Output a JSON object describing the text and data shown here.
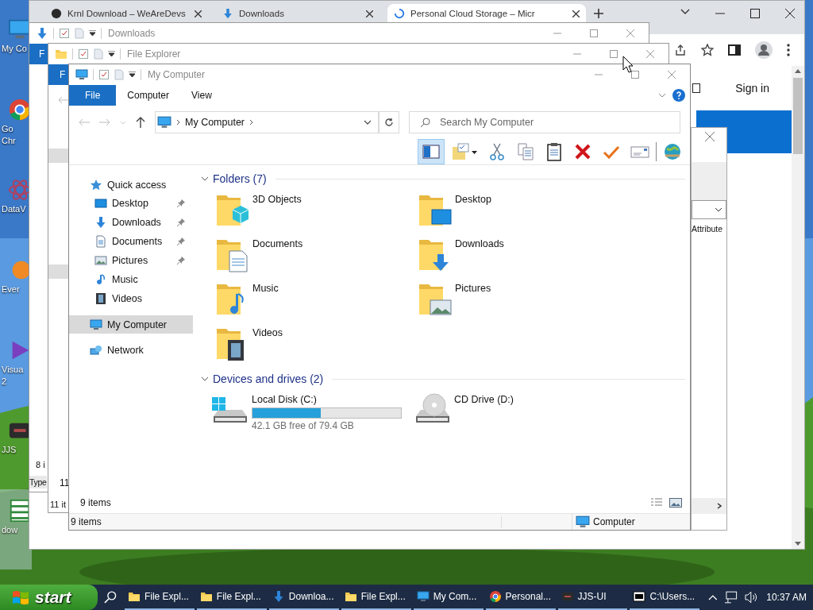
{
  "desktop": {
    "icons": [
      {
        "kind": "computer",
        "lines": [
          "My Co"
        ],
        "selected": false
      },
      {
        "kind": "chrome",
        "lines": [
          "Go",
          "Chr"
        ],
        "selected": false
      },
      {
        "kind": "atom",
        "lines": [
          "DataV"
        ],
        "selected": false
      },
      {
        "kind": "evernote",
        "lines": [
          "Ever"
        ],
        "selected": false
      },
      {
        "kind": "visual-studio",
        "lines": [
          "Visua",
          "2"
        ],
        "selected": false
      },
      {
        "kind": "jjs",
        "lines": [
          "JJS"
        ],
        "selected": false
      },
      {
        "kind": "spreadsheet",
        "lines": [
          "dow"
        ],
        "selected": true
      }
    ]
  },
  "browser": {
    "tabs": [
      {
        "title": "Krnl Download – WeAreDevs",
        "kind": "site",
        "selected": false
      },
      {
        "title": "Downloads",
        "kind": "download",
        "selected": false
      },
      {
        "title": "Personal Cloud Storage – Micr",
        "kind": "loading",
        "selected": true
      }
    ],
    "sign_in": "Sign in"
  },
  "downloads_window": {
    "title": "Downloads",
    "file_tab": "F",
    "item_count": "8 i",
    "column": "Type"
  },
  "file_explorer_window": {
    "title": "File Explorer",
    "file_tab": "F",
    "pane_count": "11",
    "status": "11 it"
  },
  "side_dialog": {
    "column": "Attribute"
  },
  "my_computer": {
    "title": "My Computer",
    "ribbon_tabs": [
      {
        "label": "File",
        "selected": true
      },
      {
        "label": "Computer",
        "selected": false
      },
      {
        "label": "View",
        "selected": false
      }
    ],
    "address": "My Computer",
    "search": {
      "placeholder": "Search My Computer"
    },
    "toolbar": [
      {
        "kind": "preview-pane",
        "selected": true
      },
      {
        "kind": "folder-options",
        "selected": false
      },
      {
        "kind": "cut",
        "selected": false
      },
      {
        "kind": "copy",
        "selected": false
      },
      {
        "kind": "paste",
        "selected": false
      },
      {
        "kind": "delete",
        "selected": false
      },
      {
        "kind": "check",
        "selected": false
      },
      {
        "kind": "envelope",
        "selected": false
      },
      {
        "kind": "globe",
        "selected": false
      }
    ],
    "nav": [
      {
        "label": "Quick access",
        "kind": "star",
        "selected": false,
        "children": [
          {
            "label": "Desktop",
            "kind": "desktop",
            "pinned": true,
            "selected": false
          },
          {
            "label": "Downloads",
            "kind": "downloads",
            "pinned": true,
            "selected": false
          },
          {
            "label": "Documents",
            "kind": "documents",
            "pinned": true,
            "selected": false
          },
          {
            "label": "Pictures",
            "kind": "pictures",
            "pinned": true,
            "selected": false
          },
          {
            "label": "Music",
            "kind": "music",
            "pinned": false,
            "selected": false
          },
          {
            "label": "Videos",
            "kind": "videos",
            "pinned": false,
            "selected": false
          }
        ]
      },
      {
        "label": "My Computer",
        "kind": "computer",
        "selected": true
      },
      {
        "label": "Network",
        "kind": "network",
        "selected": false
      }
    ],
    "folders": {
      "heading": "Folders (7)",
      "expanded": true,
      "items": [
        {
          "name": "3D Objects",
          "kind": "objects"
        },
        {
          "name": "Desktop",
          "kind": "desktop"
        },
        {
          "name": "Documents",
          "kind": "documents"
        },
        {
          "name": "Downloads",
          "kind": "downloads"
        },
        {
          "name": "Music",
          "kind": "music"
        },
        {
          "name": "Pictures",
          "kind": "pictures"
        },
        {
          "name": "Videos",
          "kind": "videos"
        }
      ]
    },
    "drives": {
      "heading": "Devices and drives (2)",
      "expanded": true,
      "items": [
        {
          "name": "Local Disk (C:)",
          "kind": "hdd",
          "level": 0.46,
          "info": "42.1 GB free of 79.4 GB"
        },
        {
          "name": "CD Drive (D:)",
          "kind": "cd"
        }
      ]
    },
    "pane_count": "9 items",
    "status": {
      "count": "9 items",
      "location": "Computer"
    }
  },
  "taskbar": {
    "start": "start",
    "items": [
      {
        "label": "File Expl...",
        "kind": "folder"
      },
      {
        "label": "File Expl...",
        "kind": "folder"
      },
      {
        "label": "Downloa...",
        "kind": "download"
      },
      {
        "label": "File Expl...",
        "kind": "folder"
      },
      {
        "label": "My Com...",
        "kind": "computer"
      },
      {
        "label": "Personal...",
        "kind": "chrome"
      },
      {
        "label": "JJS-UI",
        "kind": "jjs"
      },
      {
        "label": "C:\\Users...",
        "kind": "cmd"
      }
    ],
    "clock": "10:37 AM"
  }
}
